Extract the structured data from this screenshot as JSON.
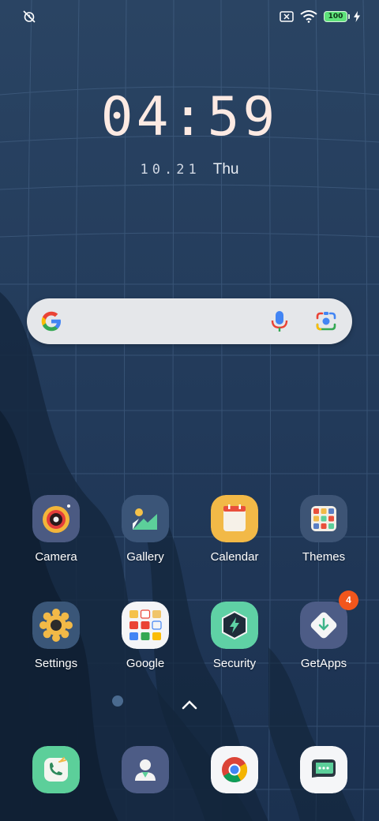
{
  "status_bar": {
    "left_icon": "alarm-off-icon",
    "right_icons": [
      "no-sim-icon",
      "wifi-icon",
      "battery-icon",
      "charging-bolt-icon"
    ],
    "battery_level": "100"
  },
  "clock": {
    "time": "04:59",
    "date": "10.21",
    "weekday": "Thu"
  },
  "search": {
    "logo": "google-g-icon",
    "mic": "mic-icon",
    "lens": "google-lens-icon"
  },
  "apps": [
    {
      "label": "Camera",
      "icon": "camera-icon"
    },
    {
      "label": "Gallery",
      "icon": "gallery-icon"
    },
    {
      "label": "Calendar",
      "icon": "calendar-icon"
    },
    {
      "label": "Themes",
      "icon": "themes-icon"
    },
    {
      "label": "Settings",
      "icon": "settings-gear-icon"
    },
    {
      "label": "Google",
      "icon": "google-folder-icon"
    },
    {
      "label": "Security",
      "icon": "security-shield-icon"
    },
    {
      "label": "GetApps",
      "icon": "getapps-icon",
      "badge": "4"
    }
  ],
  "dock": [
    {
      "name": "phone",
      "icon": "phone-icon"
    },
    {
      "name": "contacts",
      "icon": "contacts-icon"
    },
    {
      "name": "chrome",
      "icon": "chrome-icon"
    },
    {
      "name": "messages",
      "icon": "messages-icon"
    }
  ],
  "colors": {
    "background": "#1f3553",
    "clock_text": "#fdeae3",
    "badge": "#f2561c",
    "battery": "#5ee27a"
  }
}
